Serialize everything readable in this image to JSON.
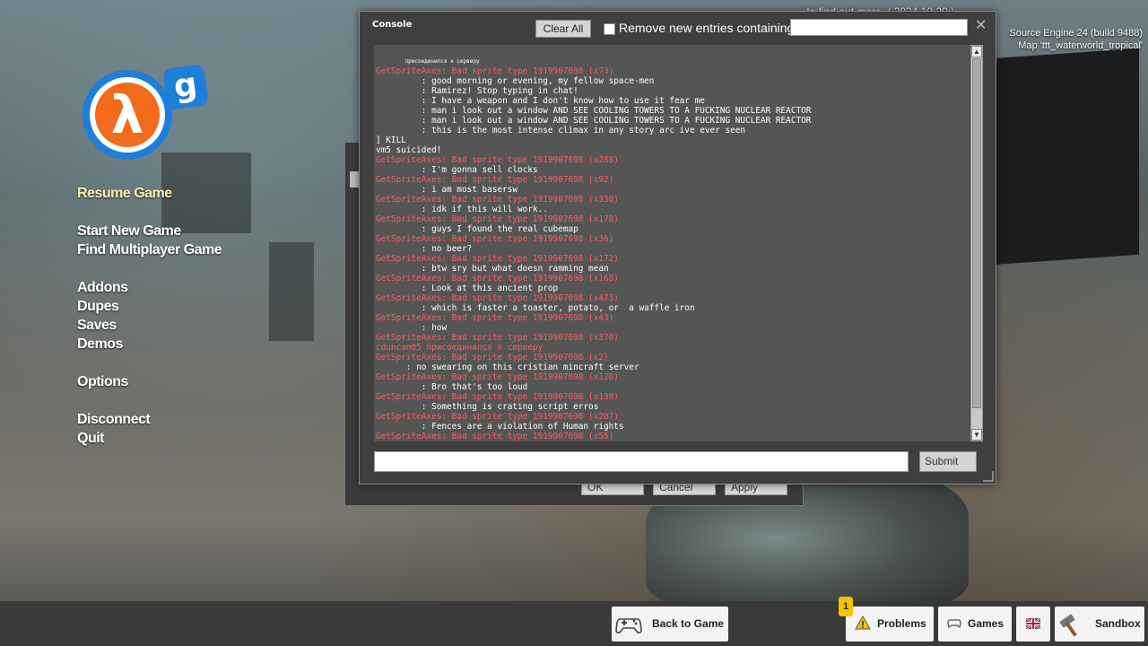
{
  "top_message": "... to find out more. ( 2024.10.29 )",
  "engine": {
    "version": "Source Engine 24 (build 9488)",
    "map": "Map 'ttt_waterworld_tropical'"
  },
  "logo": {
    "lambda": "λ",
    "g": "g"
  },
  "menu": {
    "resume": "Resume Game",
    "start_new": "Start New Game",
    "find_mp": "Find Multiplayer Game",
    "addons": "Addons",
    "dupes": "Dupes",
    "saves": "Saves",
    "demos": "Demos",
    "options": "Options",
    "disconnect": "Disconnect",
    "quit": "Quit"
  },
  "options_dialog": {
    "ok": "OK",
    "cancel": "Cancel",
    "apply": "Apply"
  },
  "console": {
    "title": "Console",
    "clear_all": "Clear All",
    "filter_label": "Remove new entries containing:",
    "filter_value": "",
    "close": "✕",
    "command_value": "",
    "submit": "Submit",
    "scroll_up": "▲",
    "scroll_down": "▼",
    "lines": [
      {
        "t": "         присоединился к серверу",
        "k": "small"
      },
      {
        "t": "GetSpriteAxes: Bad sprite type 1919907698 (x73)",
        "k": "err"
      },
      {
        "t": "         : good morning or evening, my fellow space-men",
        "k": ""
      },
      {
        "t": "         : Ramirez! Stop typing in chat!",
        "k": ""
      },
      {
        "t": "         : I have a weapon and I don't know how to use it fear me",
        "k": ""
      },
      {
        "t": "         : man i look out a window AND SEE COOLING TOWERS TO A FUCKING NUCLEAR REACTOR",
        "k": ""
      },
      {
        "t": "         : man i look out a window AND SEE COOLING TOWERS TO A FUCKING NUCLEAR REACTOR",
        "k": ""
      },
      {
        "t": "         : this is the most intense climax in any story arc ive ever seen",
        "k": ""
      },
      {
        "t": "] KILL",
        "k": ""
      },
      {
        "t": "vm5 suicided!",
        "k": ""
      },
      {
        "t": "GetSpriteAxes: Bad sprite type 1919907698 (x288)",
        "k": "err"
      },
      {
        "t": "         : I'm gonna sell clocks",
        "k": ""
      },
      {
        "t": "GetSpriteAxes: Bad sprite type 1919907698 (x92)",
        "k": "err"
      },
      {
        "t": "         : i am most basersw",
        "k": ""
      },
      {
        "t": "GetSpriteAxes: Bad sprite type 1919907698 (x338)",
        "k": "err"
      },
      {
        "t": "         : idk if this will work..",
        "k": ""
      },
      {
        "t": "GetSpriteAxes: Bad sprite type 1919907698 (x178)",
        "k": "err"
      },
      {
        "t": "         : guys I found the real cubemap",
        "k": ""
      },
      {
        "t": "GetSpriteAxes: Bad sprite type 1919907698 (x36)",
        "k": "err"
      },
      {
        "t": "         : no beer?",
        "k": ""
      },
      {
        "t": "GetSpriteAxes: Bad sprite type 1919907698 (x172)",
        "k": "err"
      },
      {
        "t": "         : btw sry but what doesn ramming mean",
        "k": ""
      },
      {
        "t": "GetSpriteAxes: Bad sprite type 1919907698 (x168)",
        "k": "err"
      },
      {
        "t": "         : Look at this ancient prop",
        "k": ""
      },
      {
        "t": "GetSpriteAxes: Bad sprite type 1919907698 (x473)",
        "k": "err"
      },
      {
        "t": "         : which is faster a toaster, potato, or  a waffle iron",
        "k": ""
      },
      {
        "t": "GetSpriteAxes: Bad sprite type 1919907698 (x43)",
        "k": "err"
      },
      {
        "t": "         : how",
        "k": ""
      },
      {
        "t": "GetSpriteAxes: Bad sprite type 1919907698 (x370)",
        "k": "err"
      },
      {
        "t": "cduncan05 присоединился к серверу",
        "k": "err"
      },
      {
        "t": "GetSpriteAxes: Bad sprite type 1919907698 (x2)",
        "k": "err"
      },
      {
        "t": "      : no swearing on this cristian mincraft server",
        "k": ""
      },
      {
        "t": "GetSpriteAxes: Bad sprite type 1919907698 (x126)",
        "k": "err"
      },
      {
        "t": "         : Bro that's too loud",
        "k": ""
      },
      {
        "t": "GetSpriteAxes: Bad sprite type 1919907698 (x138)",
        "k": "err"
      },
      {
        "t": "         : Something is crating script erros",
        "k": ""
      },
      {
        "t": "GetSpriteAxes: Bad sprite type 1919907698 (x207)",
        "k": "err"
      },
      {
        "t": "         : Fences are a violation of Human rights",
        "k": ""
      },
      {
        "t": "GetSpriteAxes: Bad sprite type 1919907698 (x55)",
        "k": "err"
      }
    ]
  },
  "bottom_bar": {
    "back_to_game": "Back to Game",
    "problems": "Problems",
    "problems_count": "1",
    "games": "Games",
    "sandbox": "Sandbox"
  },
  "colors": {
    "error_text": "#ff5d5d",
    "resume_text": "#ffeeb0",
    "badge": "#f3c300",
    "logo_blue": "#1e7fd8",
    "logo_orange": "#f26a1b"
  },
  "icons": [
    "controller-icon",
    "warning-icon",
    "games-icon",
    "uk-flag-icon",
    "hammer-icon",
    "close-icon"
  ]
}
